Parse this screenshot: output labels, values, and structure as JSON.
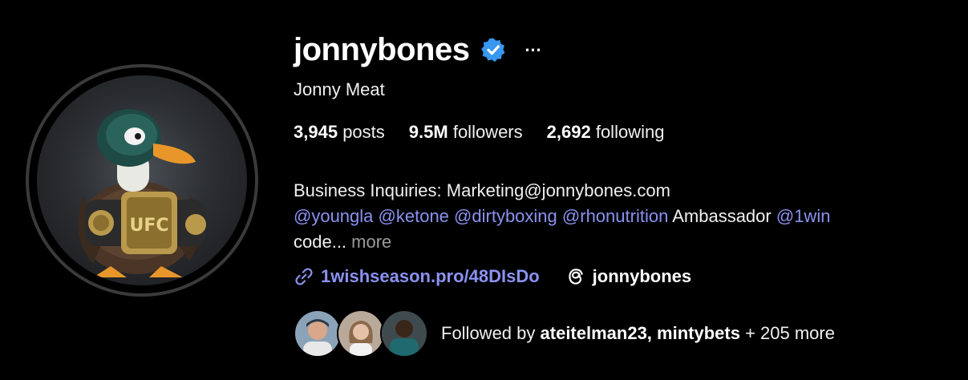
{
  "profile": {
    "username": "jonnybones",
    "full_name": "Jonny Meat",
    "verified": true,
    "more_icon": "…"
  },
  "stats": {
    "posts_count": "3,945",
    "posts_label": "posts",
    "followers_count": "9.5M",
    "followers_label": "followers",
    "following_count": "2,692",
    "following_label": "following"
  },
  "bio": {
    "line1": "Business Inquiries: Marketing@jonnybones.com",
    "mentions": [
      "@youngla",
      "@ketone",
      "@dirtyboxing",
      "@rhonutrition"
    ],
    "ambassador_text": "Ambassador",
    "mention_last": "@1win",
    "line3_text": "code...",
    "more_label": "more"
  },
  "links": {
    "external_url": "1wishseason.pro/48DIsDo",
    "threads_handle": "jonnybones"
  },
  "followed_by": {
    "prefix": "Followed by",
    "users": "ateitelman23, mintybets",
    "suffix": "+ 205 more"
  },
  "colors": {
    "background": "#000000",
    "link_accent": "#8a92f0",
    "verified_badge": "#3897f0"
  },
  "icons": {
    "verified": "verified-badge-icon",
    "more": "more-options-icon",
    "link": "link-icon",
    "threads": "threads-icon"
  }
}
